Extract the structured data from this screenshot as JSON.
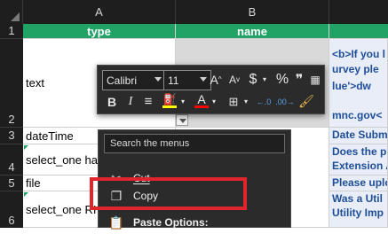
{
  "columns": {
    "a": "A",
    "b": "B"
  },
  "rows": [
    "1",
    "2",
    "3",
    "4",
    "5",
    "6"
  ],
  "header_row": {
    "a": "type",
    "b": "name"
  },
  "column_a": {
    "row2": "text",
    "row3": "dateTime",
    "row4": "select_one ha",
    "row5": "file",
    "row6": "select_one RI"
  },
  "column_c": {
    "row2": [
      "<b>If you l",
      "urvey ple",
      "lue'>dw",
      "mnc.gov<"
    ],
    "row3": "Date Subm",
    "row4": [
      "Does the p",
      "Extension A"
    ],
    "row5": "Please uplo",
    "row6": [
      "Was a Util",
      "Utility Imp"
    ]
  },
  "mini_toolbar": {
    "font_name": "Calibri",
    "font_size": "11",
    "grow_font": "A",
    "shrink_font": "A",
    "currency": "$",
    "percent": "%",
    "comma": "❞",
    "bold": "B",
    "italic": "I",
    "align": "≡",
    "font_color_letter": "A",
    "colors": {
      "highlight": "#ffff00",
      "font": "#ff0000",
      "accent": "#21a366"
    }
  },
  "context_menu": {
    "search_placeholder": "Search the menus",
    "items": [
      {
        "label": "Cut",
        "icon": "scissors-icon"
      },
      {
        "label": "Copy",
        "icon": "copy-icon"
      },
      {
        "label": "Paste Options:",
        "icon": "clipboard-icon"
      }
    ]
  }
}
